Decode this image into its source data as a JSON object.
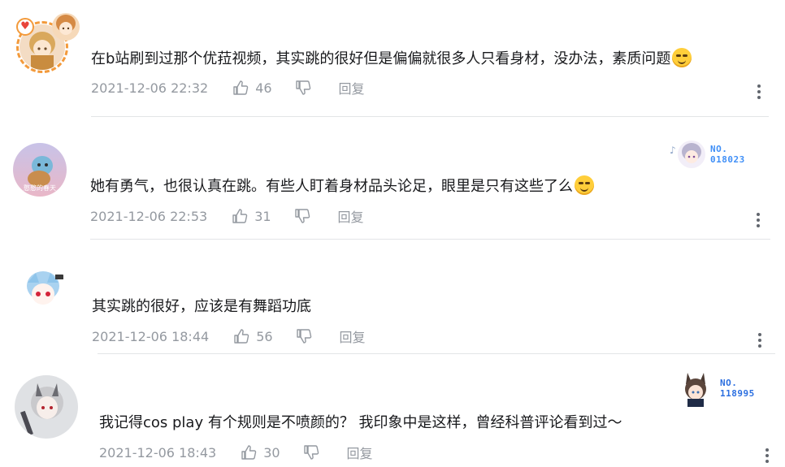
{
  "comments": [
    {
      "text": "在b站刷到过那个优菈视频，其实跳的很好但是偏偏就很多人只看身材，没办法，素质问题",
      "time": "2021-12-06 22:32",
      "likes": "46",
      "reply_label": "回复",
      "emoji": "smug-emoji",
      "avatar": "anime-girl-avatar"
    },
    {
      "text": "她有勇气，也很认真在跳。有些人盯着身材品头论足，眼里是只有这些了么",
      "time": "2021-12-06 22:53",
      "likes": "31",
      "reply_label": "回复",
      "emoji": "sly-emoji",
      "avatar": "squirtle-avatar",
      "avatar_caption": "憨憨的春天",
      "badge": {
        "label": "NO.",
        "number": "018023"
      }
    },
    {
      "text": "其实跳的很好，应该是有舞蹈功底",
      "time": "2021-12-06 18:44",
      "likes": "56",
      "reply_label": "回复",
      "avatar": "chibi-girl-avatar"
    },
    {
      "text": "我记得cos play 有个规则是不喷颜的？ 我印象中是这样，曾经科普评论看到过～",
      "time": "2021-12-06 18:43",
      "likes": "30",
      "reply_label": "回复",
      "avatar": "arknights-girl-avatar",
      "badge": {
        "label": "NO.",
        "number": "118995"
      }
    }
  ],
  "colors": {
    "text": "#18191c",
    "meta": "#9499a0",
    "divider": "#e3e5e7",
    "badge": "#3f8ff7",
    "frame": "#f39a3b"
  }
}
